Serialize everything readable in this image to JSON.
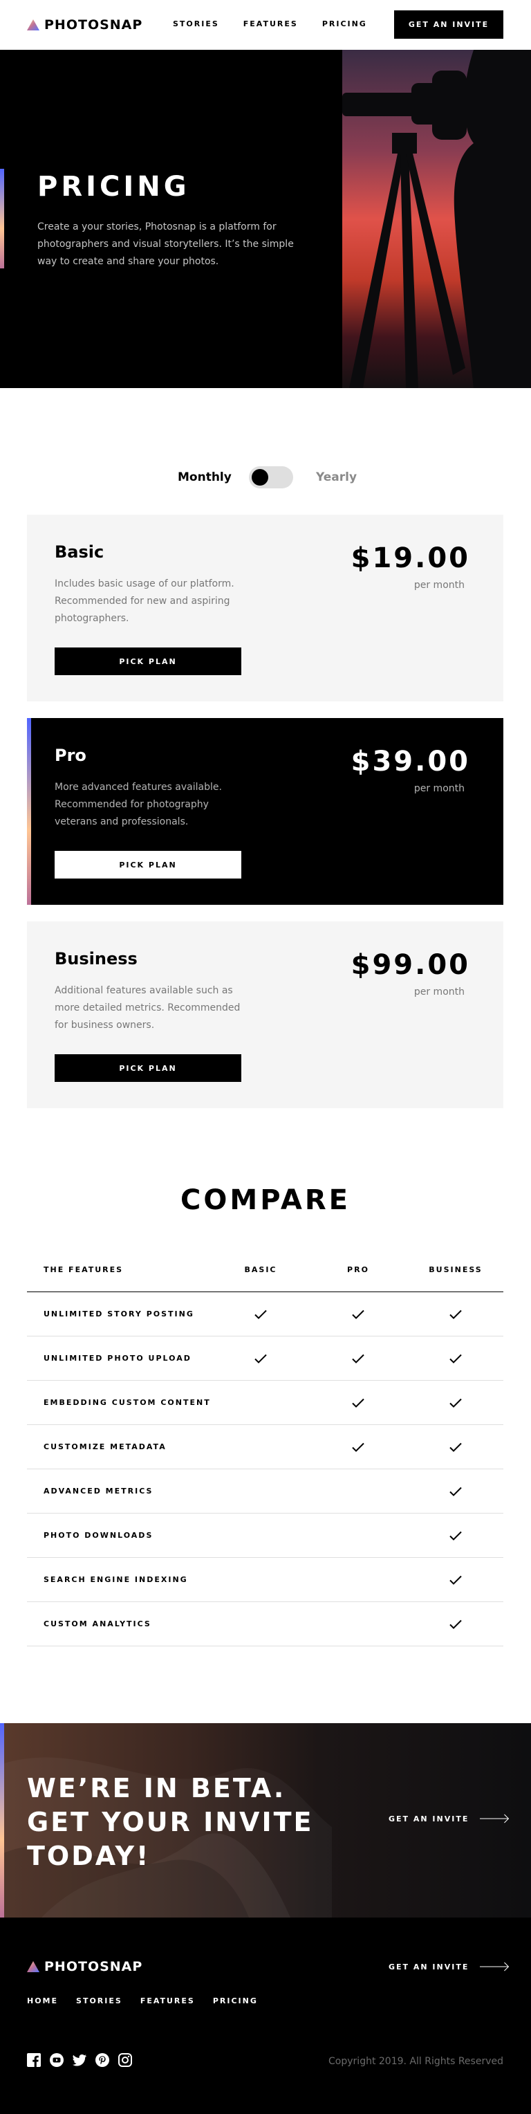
{
  "brand": {
    "name": "PHOTOSNAP"
  },
  "nav": {
    "links": [
      "STORIES",
      "FEATURES",
      "PRICING"
    ],
    "cta_label": "GET AN INVITE"
  },
  "hero": {
    "title": "PRICING",
    "text": "Create a your stories, Photosnap is a platform for photographers and visual storytellers. It’s the simple way to create and share your photos."
  },
  "billing_toggle": {
    "monthly_label": "Monthly",
    "yearly_label": "Yearly",
    "selected": "Monthly"
  },
  "plans": [
    {
      "name": "Basic",
      "description": "Includes basic usage of our platform. Recommended for new and aspiring photographers.",
      "price": "$19.00",
      "period": "per month",
      "button_label": "PICK PLAN"
    },
    {
      "name": "Pro",
      "description": "More advanced features available. Recommended for photography veterans and professionals.",
      "price": "$39.00",
      "period": "per month",
      "button_label": "PICK PLAN"
    },
    {
      "name": "Business",
      "description": "Additional features available such as more detailed metrics. Recommended for business owners.",
      "price": "$99.00",
      "period": "per month",
      "button_label": "PICK PLAN"
    }
  ],
  "compare": {
    "title": "COMPARE",
    "headers": [
      "THE FEATURES",
      "BASIC",
      "PRO",
      "BUSINESS"
    ],
    "rows": [
      {
        "feature": "UNLIMITED STORY POSTING",
        "basic": true,
        "pro": true,
        "business": true
      },
      {
        "feature": "UNLIMITED PHOTO UPLOAD",
        "basic": true,
        "pro": true,
        "business": true
      },
      {
        "feature": "EMBEDDING CUSTOM CONTENT",
        "basic": false,
        "pro": true,
        "business": true
      },
      {
        "feature": "CUSTOMIZE METADATA",
        "basic": false,
        "pro": true,
        "business": true
      },
      {
        "feature": "ADVANCED METRICS",
        "basic": false,
        "pro": false,
        "business": true
      },
      {
        "feature": "PHOTO DOWNLOADS",
        "basic": false,
        "pro": false,
        "business": true
      },
      {
        "feature": "SEARCH ENGINE INDEXING",
        "basic": false,
        "pro": false,
        "business": true
      },
      {
        "feature": "CUSTOM ANALYTICS",
        "basic": false,
        "pro": false,
        "business": true
      }
    ]
  },
  "beta": {
    "title_lines": [
      "WE’RE IN BETA.",
      "GET YOUR INVITE",
      "TODAY!"
    ],
    "cta_label": "GET AN INVITE"
  },
  "footer": {
    "links": [
      "HOME",
      "STORIES",
      "FEATURES",
      "PRICING"
    ],
    "cta_label": "GET AN INVITE",
    "social_icons": [
      "facebook-icon",
      "youtube-icon",
      "twitter-icon",
      "pinterest-icon",
      "instagram-icon"
    ],
    "copyright": "Copyright 2019. All Rights Reserved"
  },
  "colors": {
    "accent_start": "#5165ff",
    "accent_mid": "#ffc593",
    "accent_end": "#bc7198",
    "black": "#000000",
    "light_gray": "#f5f5f5"
  }
}
